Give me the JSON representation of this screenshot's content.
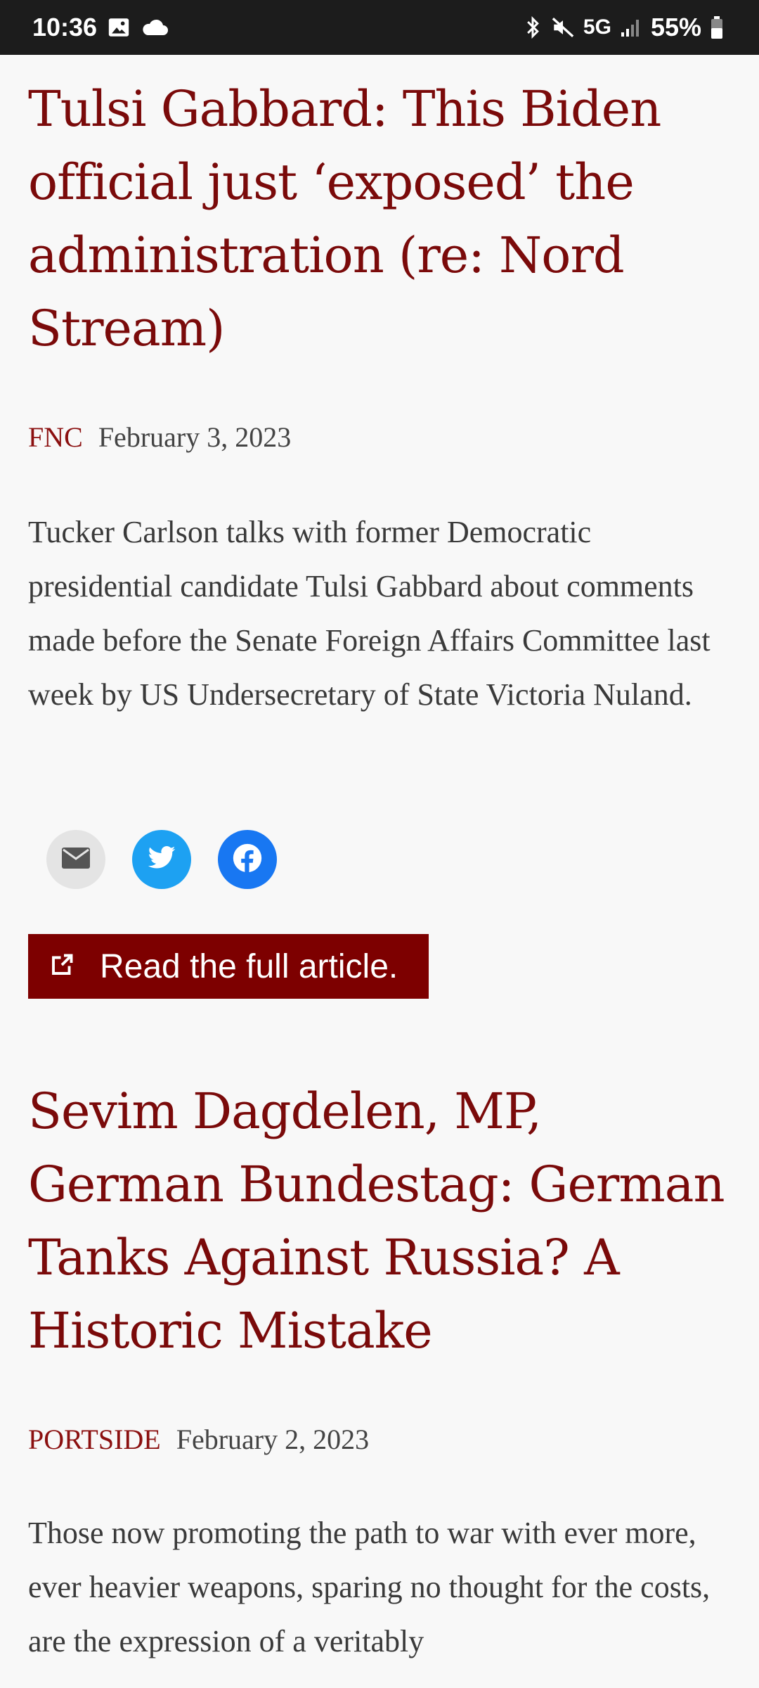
{
  "status_bar": {
    "time": "10:36",
    "left_icons": [
      "image-icon",
      "cloud-icon"
    ],
    "network": "5G",
    "battery": "55%",
    "right_icons": [
      "bluetooth-icon",
      "mute-icon",
      "signal-icon",
      "battery-icon"
    ]
  },
  "articles": [
    {
      "title": "Tulsi Gabbard: This Biden official just ‘exposed’ the administration (re: Nord Stream)",
      "source": "FNC",
      "date": "February 3, 2023",
      "excerpt": "Tucker Carlson talks with former Democratic presidential candidate Tulsi Gabbard about comments made before the Senate Foreign Affairs Committee last week by US Undersecretary of State Victoria Nuland.",
      "share_icons": [
        "email-icon",
        "twitter-icon",
        "facebook-icon"
      ],
      "read_more": "Read the full article."
    },
    {
      "title": "Sevim Dagdelen, MP, German Bundestag: German Tanks Against Russia? A Historic Mistake",
      "source": "PORTSIDE",
      "date": "February 2, 2023",
      "excerpt": "Those now promoting the path to war with ever more, ever heavier weapons, sparing no thought for the costs, are the expression of a veritably"
    }
  ],
  "colors": {
    "title": "#7a0a0a",
    "source": "#8b1010",
    "read_button_bg": "#7d0000",
    "twitter": "#1da1f2",
    "facebook": "#1877f2",
    "status_bar_bg": "#1c1c1c"
  }
}
